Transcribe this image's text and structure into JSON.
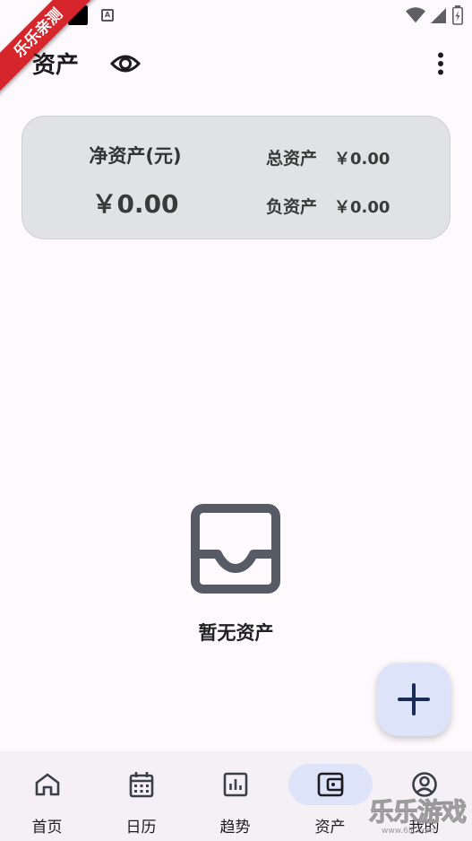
{
  "watermark": {
    "ribbon": "乐乐亲测",
    "corner": "乐乐游戏",
    "corner_url": "www.6lll.com"
  },
  "appbar": {
    "title": "资产"
  },
  "summary": {
    "net_label": "净资产(元)",
    "net_value": "￥0.00",
    "total_label": "总资产",
    "total_value": "￥0.00",
    "liability_label": "负资产",
    "liability_value": "￥0.00"
  },
  "empty_state": {
    "text": "暂无资产"
  },
  "nav": {
    "items": [
      {
        "label": "首页",
        "icon": "home-icon"
      },
      {
        "label": "日历",
        "icon": "calendar-icon"
      },
      {
        "label": "趋势",
        "icon": "chart-icon"
      },
      {
        "label": "资产",
        "icon": "wallet-icon",
        "active": true
      },
      {
        "label": "我的",
        "icon": "account-icon"
      }
    ]
  },
  "colors": {
    "card_bg": "#e1e2e6",
    "accent_container": "#dde3f8",
    "fab_icon": "#1a2b55",
    "ribbon": "#d6262b"
  }
}
